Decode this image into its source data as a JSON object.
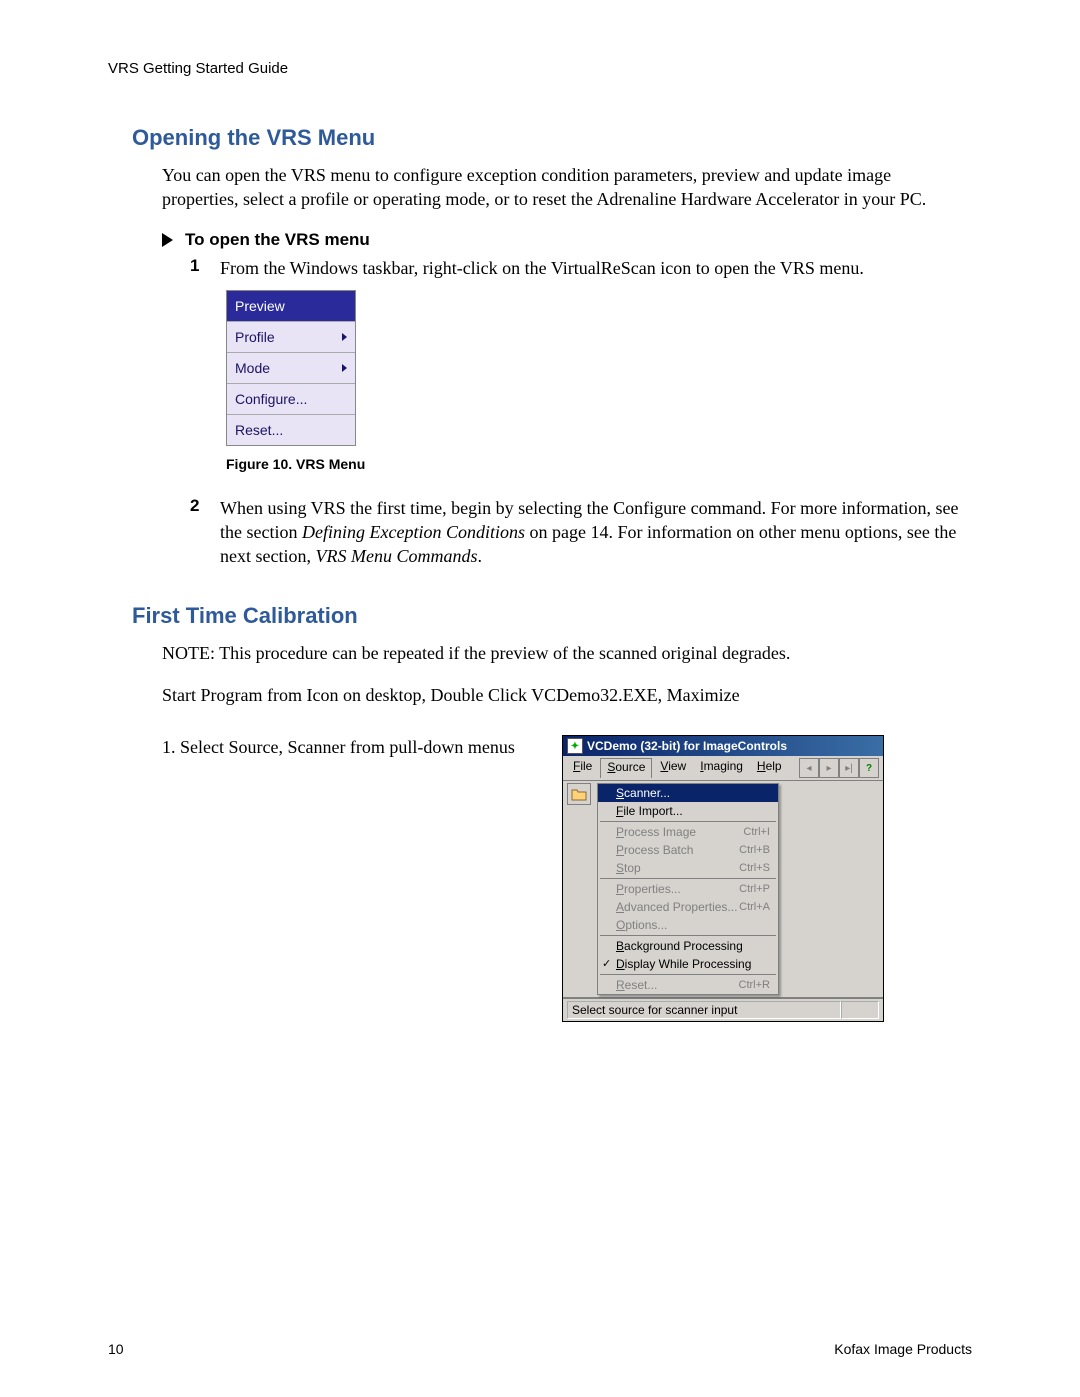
{
  "header": "VRS Getting Started Guide",
  "section1": {
    "title": "Opening the VRS Menu",
    "intro": "You can open the VRS menu to configure exception condition parameters, preview and update image properties, select a profile or operating mode, or to reset the Adrenaline Hardware Accelerator in your PC.",
    "proc_title": "To open the VRS menu",
    "step1_num": "1",
    "step1": "From the Windows taskbar, right-click on the VirtualReScan icon to open the VRS menu.",
    "menu": {
      "items": [
        "Preview",
        "Profile",
        "Mode",
        "Configure...",
        "Reset..."
      ]
    },
    "fig_caption": "Figure 10.  VRS Menu",
    "step2_num": "2",
    "step2_a": "When using VRS the first time, begin by selecting the Configure command. For more information, see the section ",
    "step2_i1": "Defining Exception Conditions",
    "step2_b": " on page 14. For information on other menu options, see the next section, ",
    "step2_i2": "VRS Menu Commands",
    "step2_c": "."
  },
  "section2": {
    "title": "First Time Calibration",
    "note": "NOTE: This procedure can be repeated if the preview of the scanned original degrades.",
    "start": "Start Program from Icon on desktop, Double Click VCDemo32.EXE, Maximize",
    "step1": "1.  Select Source, Scanner from pull-down menus"
  },
  "vcdemo": {
    "title": "VCDemo (32-bit) for ImageControls",
    "menubar": [
      "File",
      "Source",
      "View",
      "Imaging",
      "Help"
    ],
    "nav_help": "?",
    "dropdown": [
      {
        "label": "Scanner...",
        "shortcut": "",
        "enabled": true,
        "selected": true
      },
      {
        "label": "File Import...",
        "shortcut": "",
        "enabled": true
      },
      {
        "sep": true
      },
      {
        "label": "Process Image",
        "shortcut": "Ctrl+I",
        "enabled": false
      },
      {
        "label": "Process Batch",
        "shortcut": "Ctrl+B",
        "enabled": false
      },
      {
        "label": "Stop",
        "shortcut": "Ctrl+S",
        "enabled": false
      },
      {
        "sep": true
      },
      {
        "label": "Properties...",
        "shortcut": "Ctrl+P",
        "enabled": false
      },
      {
        "label": "Advanced Properties...",
        "shortcut": "Ctrl+A",
        "enabled": false
      },
      {
        "label": "Options...",
        "shortcut": "",
        "enabled": false
      },
      {
        "sep": true
      },
      {
        "label": "Background Processing",
        "shortcut": "",
        "enabled": true
      },
      {
        "label": "Display While Processing",
        "shortcut": "",
        "enabled": true,
        "checked": true
      },
      {
        "sep": true
      },
      {
        "label": "Reset...",
        "shortcut": "Ctrl+R",
        "enabled": false
      }
    ],
    "status": "Select source for scanner input"
  },
  "footer": {
    "page": "10",
    "right": "Kofax Image Products"
  }
}
